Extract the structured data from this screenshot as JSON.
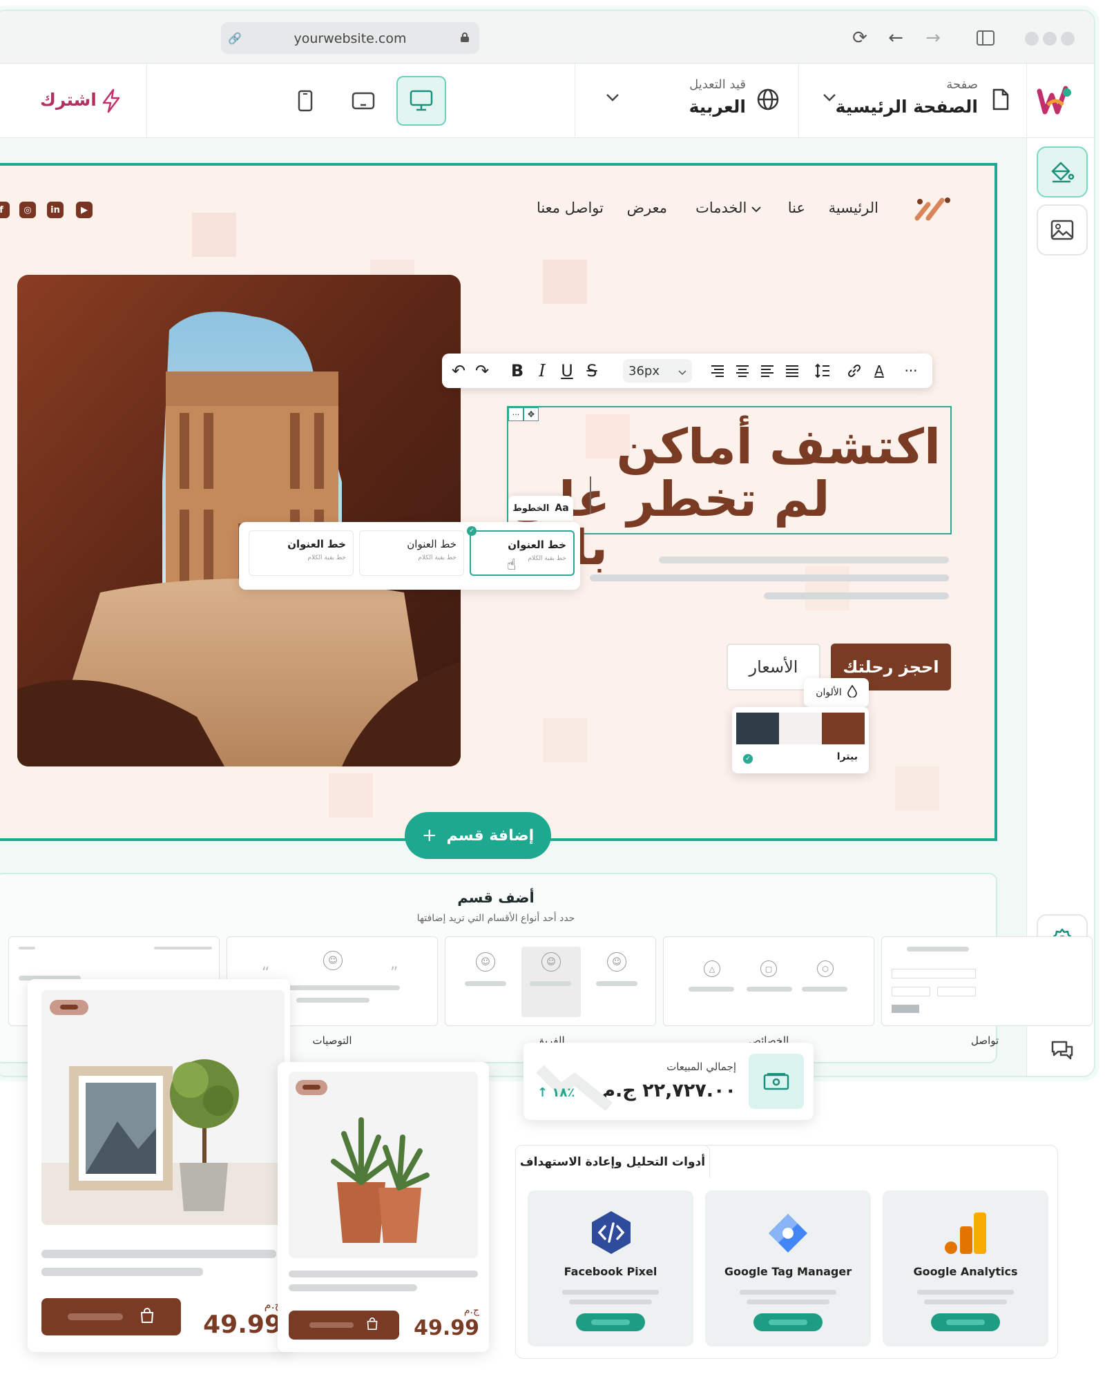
{
  "browser": {
    "url": "yourwebsite.com"
  },
  "toolbar": {
    "page_caption": "صفحة",
    "page_name": "الصفحة الرئيسية",
    "lang_caption": "قيد التعديل",
    "lang_name": "العربية",
    "subscribe_label": "اشترك",
    "devices": [
      "desktop",
      "tablet",
      "mobile"
    ],
    "active_device": "desktop"
  },
  "site_nav": {
    "items": [
      "الرئيسية",
      "عنا",
      "الخدمات",
      "معرض",
      "تواصل معنا"
    ],
    "social": [
      "youtube",
      "linkedin",
      "instagram",
      "facebook"
    ]
  },
  "editor": {
    "font_size": "36px",
    "heading_line1": "اكتشف أماكن",
    "heading_line2": "لم تخطر على بالك",
    "fonts_tab": "الخطوط",
    "font_cards": [
      {
        "title": "خط العنوان",
        "sub": "خط بقية الكلام",
        "selected": true
      },
      {
        "title": "خط العنوان",
        "sub": "خط بقية الكلام",
        "selected": false
      },
      {
        "title": "خط العنوان",
        "sub": "خط بقية الكلام",
        "selected": false
      }
    ],
    "cta_primary": "احجز رحلتك",
    "cta_secondary": "الأسعار",
    "colors_tab": "الألوان",
    "palette_name": "بيترا",
    "palette_colors": [
      "#7a3b24",
      "#f3f1ef",
      "#2f3b46"
    ]
  },
  "add_section": {
    "button_label": "إضافة قسم",
    "title": "أضف قسم",
    "subtitle": "حدد أحد أنواع الأقسام التي تريد إضافتها",
    "types": [
      "تواصل",
      "الخصائص",
      "الفريق",
      "التوصيات"
    ]
  },
  "products": [
    {
      "price": "49.99",
      "currency": "ج.م"
    },
    {
      "price": "49.99",
      "currency": "ج.م"
    }
  ],
  "sales": {
    "label": "إجمالي المبيعات",
    "value": "٢٢,٧٢٧.٠٠ ج.م",
    "change": "١٨٪"
  },
  "analytics": {
    "title": "أدوات التحليل وإعادة الاستهداف",
    "tools": [
      "Google Analytics",
      "Google Tag Manager",
      "Facebook Pixel"
    ]
  },
  "colors": {
    "accent": "#1ea88f",
    "brand": "#7a3b24",
    "hero_bg": "#fdf1ec"
  }
}
